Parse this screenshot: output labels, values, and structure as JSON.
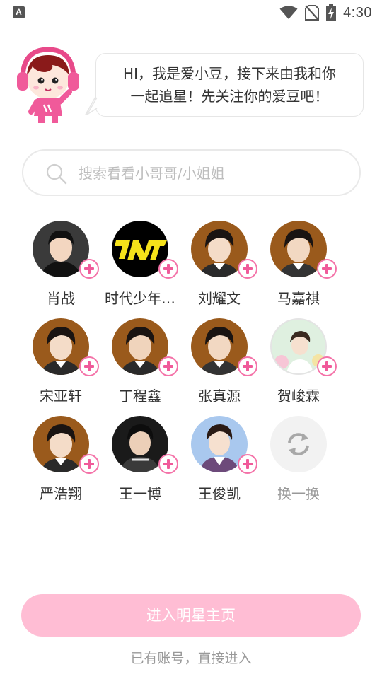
{
  "status_bar": {
    "time": "4:30",
    "app_badge": "A",
    "icons": [
      "wifi-icon",
      "no-sim-icon",
      "battery-charging-icon"
    ]
  },
  "greeting": {
    "line1": "HI，我是爱小豆，接下来由我和你",
    "line2": "一起追星！先关注你的爱豆吧！"
  },
  "search": {
    "placeholder": "搜索看看小哥哥/小姐姐",
    "value": ""
  },
  "stars": [
    {
      "name": "肖战",
      "avatar_bg": "#3a3a3a"
    },
    {
      "name": "时代少年…",
      "avatar_bg": "#000000"
    },
    {
      "name": "刘耀文",
      "avatar_bg": "#9a5a1c"
    },
    {
      "name": "马嘉祺",
      "avatar_bg": "#9a5a1c"
    },
    {
      "name": "宋亚轩",
      "avatar_bg": "#9a5a1c"
    },
    {
      "name": "丁程鑫",
      "avatar_bg": "#9a5a1c"
    },
    {
      "name": "张真源",
      "avatar_bg": "#9a5a1c"
    },
    {
      "name": "贺峻霖",
      "avatar_bg": "#cfe8d4"
    },
    {
      "name": "严浩翔",
      "avatar_bg": "#9a5a1c"
    },
    {
      "name": "王一博",
      "avatar_bg": "#1a1a1a"
    },
    {
      "name": "王俊凯",
      "avatar_bg": "#a9c8ee"
    }
  ],
  "refresh": {
    "label": "换一换"
  },
  "actions": {
    "enter_label": "进入明星主页",
    "login_label": "已有账号，直接进入"
  },
  "colors": {
    "accent_pink": "#f05a9a",
    "button_pink": "#ffbdd4"
  }
}
